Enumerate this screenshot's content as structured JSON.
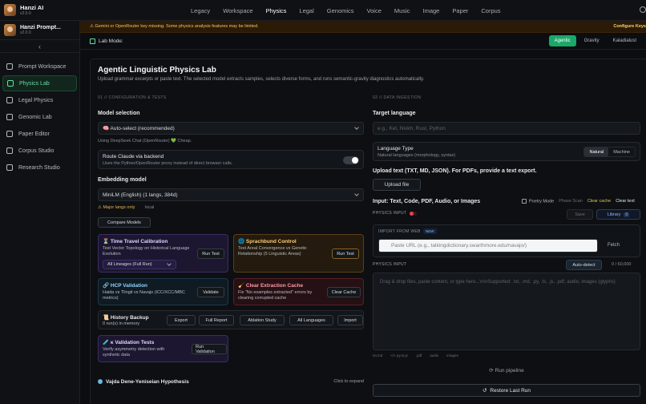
{
  "app": {
    "name": "Hanzi AI",
    "version": "v2.0.0"
  },
  "workspace": {
    "name": "Hanzi Prompt...",
    "version": "v2.0.0"
  },
  "nav": {
    "items": [
      "Legacy",
      "Workspace",
      "Physics",
      "Legal",
      "Genomics",
      "Voice",
      "Music",
      "Image",
      "Paper",
      "Corpus"
    ],
    "active": "Physics"
  },
  "sidebar": {
    "items": [
      {
        "label": "Prompt Workspace",
        "icon": "workspace-icon"
      },
      {
        "label": "Physics Lab",
        "icon": "flask-icon",
        "active": true
      },
      {
        "label": "Legal Physics",
        "icon": "scale-icon"
      },
      {
        "label": "Genomic Lab",
        "icon": "dna-icon"
      },
      {
        "label": "Paper Editor",
        "icon": "document-icon"
      },
      {
        "label": "Corpus Studio",
        "icon": "database-icon"
      },
      {
        "label": "Research Studio",
        "icon": "chart-icon"
      }
    ]
  },
  "warning": {
    "text": "⚠ Gemini or OpenRouter key missing. Some physics analysis features may be limited.",
    "action": "Configure Keys"
  },
  "lab": {
    "label": "Lab Mode:",
    "modes": [
      "Agentic",
      "Gravity",
      "Kaladialust"
    ],
    "active_mode": "Agentic"
  },
  "main": {
    "title": "Agentic Linguistic Physics Lab",
    "subtitle": "Upload grammar excerpts or paste text. The selected model extracts samples, selects diverse forms, and runs semantic-gravity diagnostics automatically.",
    "section_left": "01 // CONFIGURATION & TESTS",
    "section_right": "02 // DATA INGESTION"
  },
  "config": {
    "model_label": "Model selection",
    "model_value": "🧠 Auto-select (recommended)",
    "model_note": "Using DeepSeek Chat (OpenRouter) 💚 Cheap.",
    "route_title": "Route Claude via backend",
    "route_desc": "Uses the Python/OpenRouter proxy instead of direct browser calls.",
    "embedding_label": "Embedding model",
    "embedding_value": "MiniLM (English) (1 langs, 384d)",
    "major_langs": "⚠ Major langs only",
    "local": "local",
    "compare_btn": "Compare Models"
  },
  "cards": {
    "time_title": "⌛ Time Travel Calibration",
    "time_desc": "Test Vector Topology on Historical Language Evolution",
    "time_select": "All Lineages (Full Run)",
    "time_btn": "Run Test",
    "sprach_title": "🌐 Sprachbund Control",
    "sprach_desc": "Test Areal Convergence vs Genetic Relationship (5 Linguistic Areas)",
    "sprach_btn": "Run Test",
    "hcp_title": "🔗 HCP Validation",
    "hcp_desc": "Haida vs Tlingit vs Navajo (ICC/XCC/MBC metrics)",
    "hcp_btn": "Validate",
    "cache_title": "🧹 Clear Extraction Cache",
    "cache_desc": "Fix \"No examples extracted\" errors by clearing corrupted cache",
    "cache_btn": "Clear Cache",
    "history_title": "📜 History Backup",
    "history_desc": "0 run(s) in memory",
    "history_btns": [
      "Export",
      "Full Report",
      "Ablation Study",
      "All Languages",
      "Import"
    ],
    "k_title": "🧪 κ Validation Tests",
    "k_desc": "Verify asymmetry detection with synthetic data",
    "k_btn": "Run Validation",
    "hypothesis": "Vajda Dene-Yeniseian Hypothesis",
    "expand": "Click to expand"
  },
  "ingest": {
    "target_label": "Target language",
    "target_placeholder": "e.g., Ket, Nivkh, Rust, Python",
    "lang_type_title": "Language Type",
    "lang_type_desc": "Natural languages (morphology, syntax)",
    "lang_type_opts": [
      "Natural",
      "Machine"
    ],
    "upload_label": "Upload text (TXT, MD, JSON). For PDFs, provide a text export.",
    "upload_btn": "Upload file",
    "input_label": "Input: Text, Code, PDF, Audio, or Images",
    "poetry": "Poetry Mode",
    "phase_scan": "Phase Scan",
    "clear_cache": "Clear cache",
    "clear_text": "Clear text",
    "physics_input_tag": "PHYSICS INPUT",
    "save_btn": "Save",
    "library_btn": "Library",
    "library_count": "0",
    "import_web": "IMPORT FROM WEB",
    "new_badge": "NEW",
    "url_placeholder": "Paste URL (e.g., talkingdictionary.swarthmore.edu/navajo/)",
    "fetch_btn": "Fetch",
    "physics_input_label": "PHYSICS INPUT",
    "auto_detect": "Auto-detect",
    "char_count": "0 / 60,000",
    "textarea_placeholder": "Drag & drop files, paste content, or type here...\\n\\nSupported: .txt, .md, .py, .ts, .js, .pdf, audio, images (glyphs)",
    "formats": [
      "txt,md",
      "</> py,ts,js",
      ".pdf",
      "audio",
      "images"
    ],
    "run_pipeline": "Run pipeline",
    "restore": "Restore Last Run"
  },
  "colors": {
    "accent": "#1aa86a",
    "warning": "#f0c56a"
  }
}
